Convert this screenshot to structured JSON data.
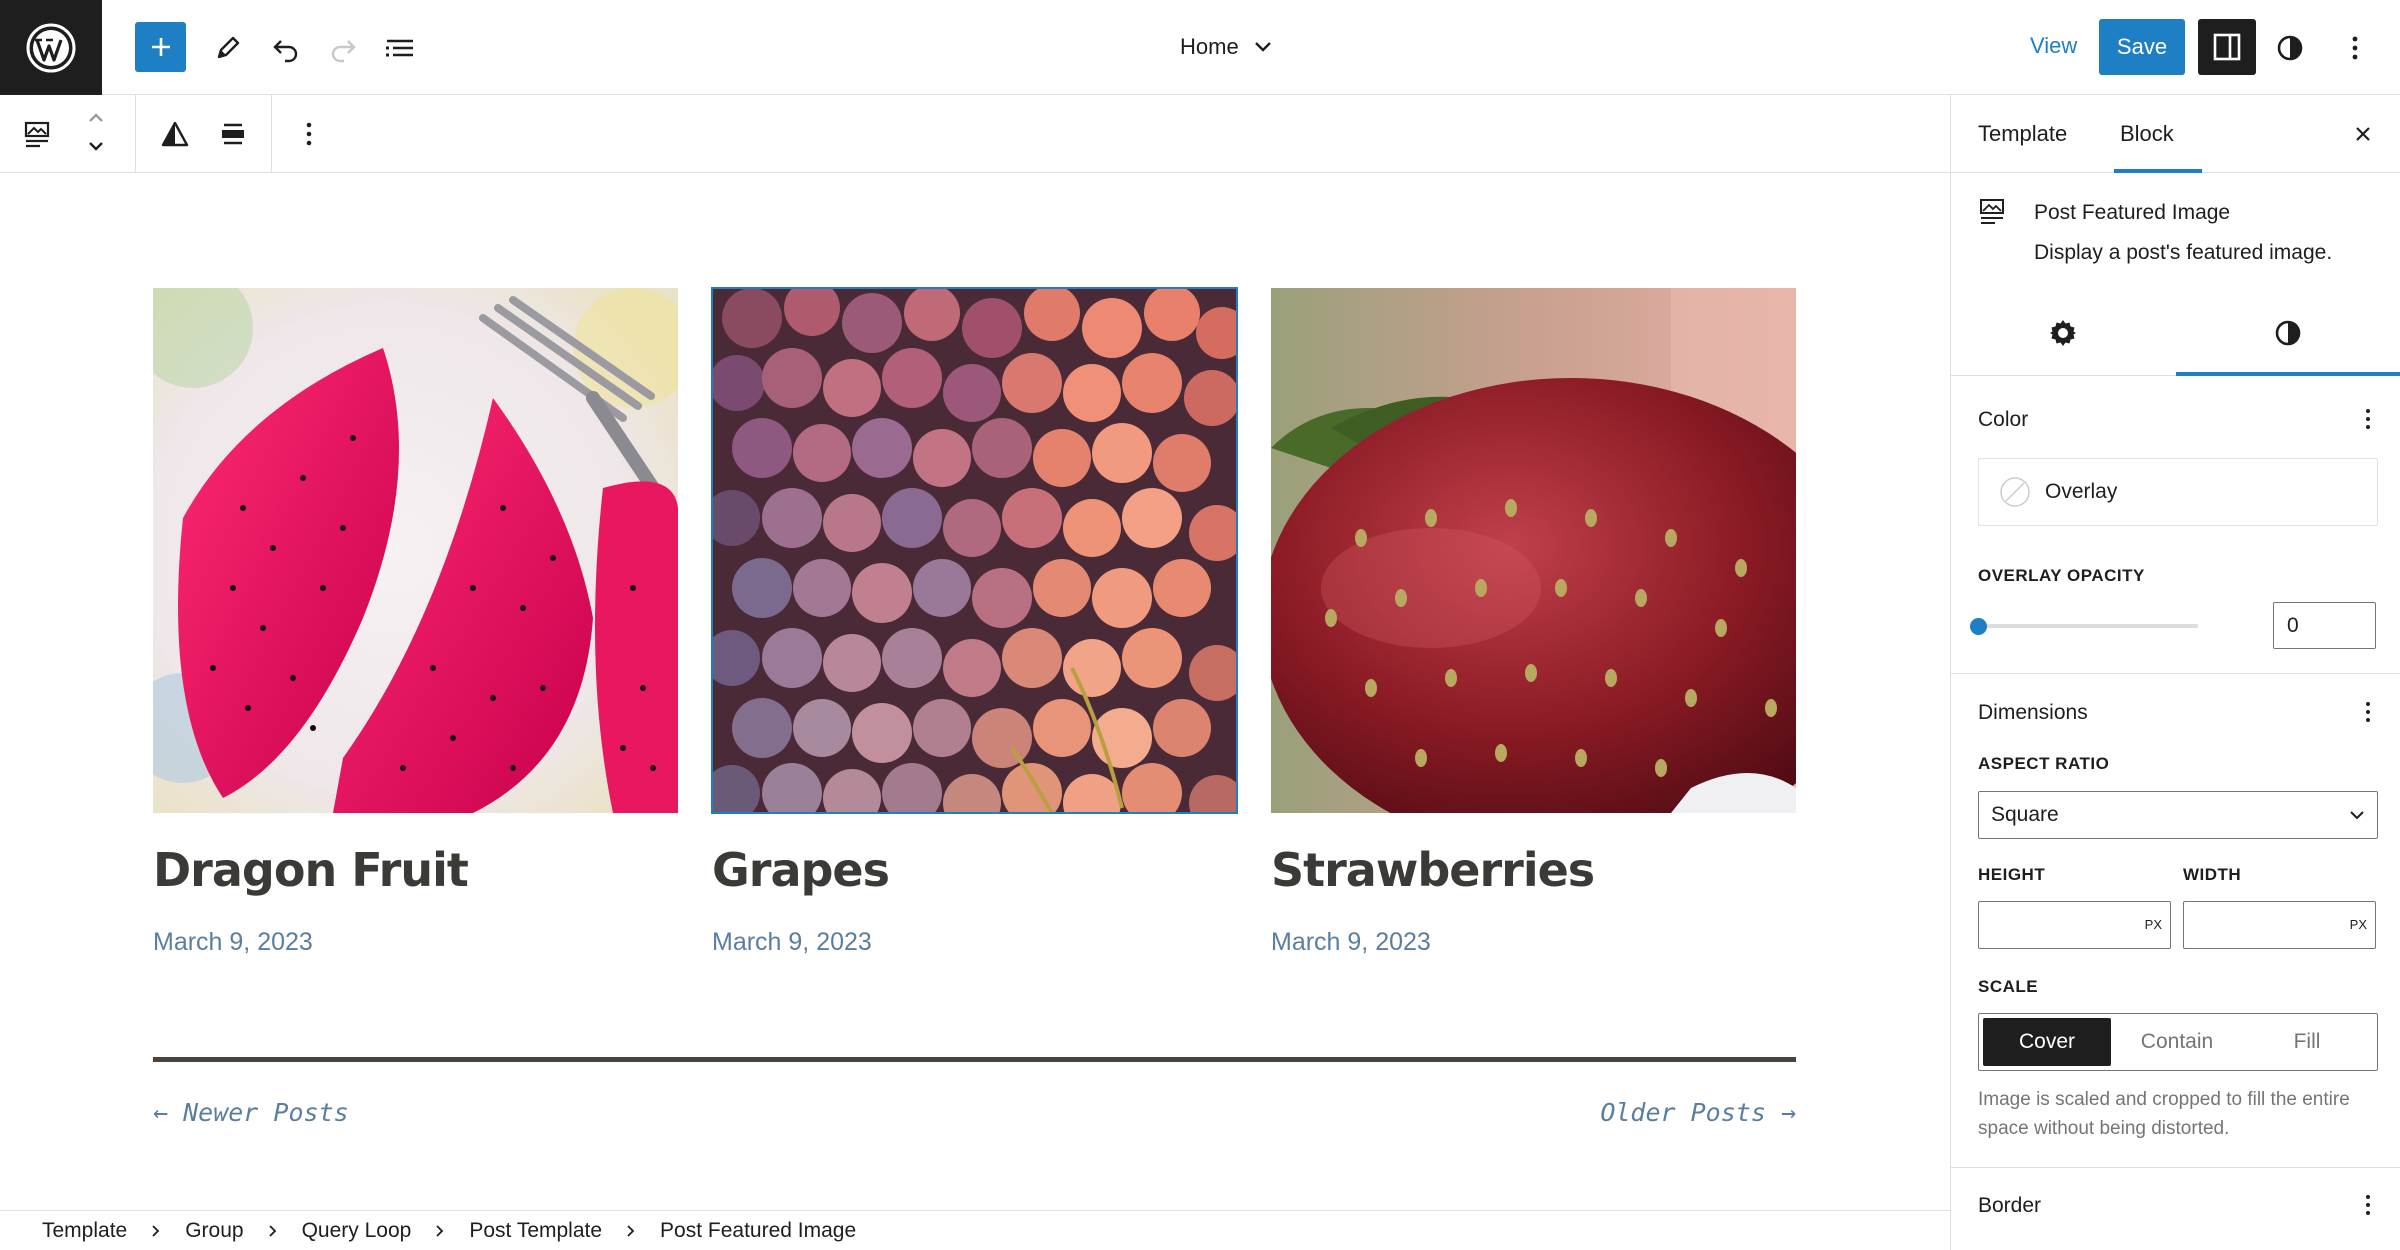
{
  "topbar": {
    "document_title": "Home",
    "view_label": "View",
    "save_label": "Save"
  },
  "canvas": {
    "posts": [
      {
        "title": "Dragon Fruit",
        "date": "March 9, 2023"
      },
      {
        "title": "Grapes",
        "date": "March 9, 2023"
      },
      {
        "title": "Strawberries",
        "date": "March 9, 2023"
      }
    ],
    "pagination": {
      "newer": "← Newer Posts",
      "older": "Older Posts →"
    }
  },
  "breadcrumb": [
    "Template",
    "Group",
    "Query Loop",
    "Post Template",
    "Post Featured Image"
  ],
  "sidebar": {
    "tabs": [
      "Template",
      "Block"
    ],
    "active_tab": "Block",
    "block_card": {
      "title": "Post Featured Image",
      "description": "Display a post's featured image."
    },
    "color": {
      "heading": "Color",
      "overlay_label": "Overlay",
      "opacity_label": "OVERLAY OPACITY",
      "opacity_value": "0"
    },
    "dimensions": {
      "heading": "Dimensions",
      "aspect_ratio_label": "ASPECT RATIO",
      "aspect_ratio_value": "Square",
      "height_label": "HEIGHT",
      "width_label": "WIDTH",
      "unit": "PX",
      "scale_label": "SCALE",
      "scale_options": [
        "Cover",
        "Contain",
        "Fill"
      ],
      "scale_active": "Cover",
      "scale_help": "Image is scaled and cropped to fill the entire space without being distorted."
    },
    "border": {
      "heading": "Border"
    }
  },
  "colors": {
    "accent": "#1e7fc4",
    "dark": "#1e1e1e",
    "title_text": "#3b3a36",
    "date_text": "#5a7ea0"
  }
}
